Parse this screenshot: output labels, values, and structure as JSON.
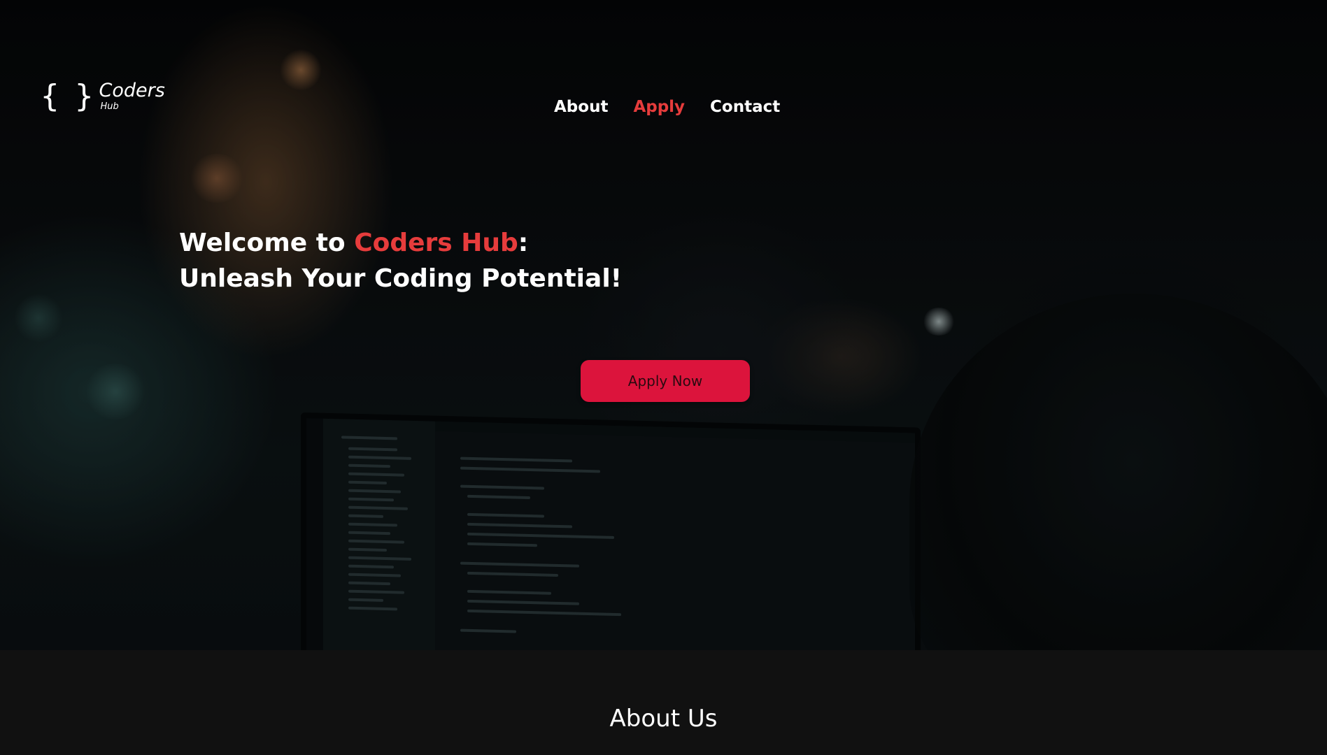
{
  "brand": {
    "icon": "{ }",
    "name": "Coders",
    "sub": "Hub"
  },
  "nav": {
    "items": [
      {
        "label": "About",
        "active": false
      },
      {
        "label": "Apply",
        "active": true
      },
      {
        "label": "Contact",
        "active": false
      }
    ]
  },
  "hero": {
    "headline_prefix": "Welcome to ",
    "headline_accent": "Coders Hub",
    "headline_suffix": ":",
    "headline_line2": "Unleash Your Coding Potential!",
    "cta_label": "Apply Now"
  },
  "about": {
    "title": "About Us"
  },
  "colors": {
    "accent": "#e63c3c",
    "button": "#dc143c",
    "background": "#111111"
  }
}
